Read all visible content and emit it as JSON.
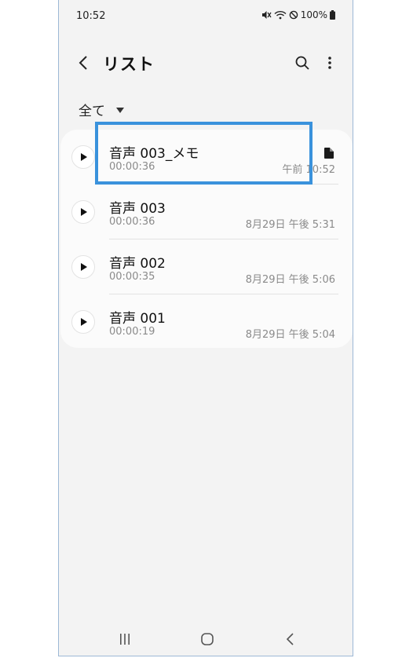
{
  "status_bar": {
    "time": "10:52",
    "battery": "100%",
    "icons": [
      "mute-icon",
      "wifi-icon",
      "blocked-icon",
      "battery-icon"
    ]
  },
  "app_bar": {
    "title": "リスト",
    "icons": [
      "back-icon",
      "search-icon",
      "more-vert-icon"
    ]
  },
  "filter": {
    "label": "全て"
  },
  "recordings": [
    {
      "title": "音声 003_メモ",
      "duration": "00:00:36",
      "date": "午前 10:52",
      "has_memo": true
    },
    {
      "title": "音声 003",
      "duration": "00:00:36",
      "date": "8月29日 午後 5:31",
      "has_memo": false
    },
    {
      "title": "音声 002",
      "duration": "00:00:35",
      "date": "8月29日 午後 5:06",
      "has_memo": false
    },
    {
      "title": "音声 001",
      "duration": "00:00:19",
      "date": "8月29日 午後 5:04",
      "has_memo": false
    }
  ],
  "colors": {
    "highlight": "#3a92dc",
    "background": "#f3f3f3",
    "card": "#fbfbfb"
  }
}
